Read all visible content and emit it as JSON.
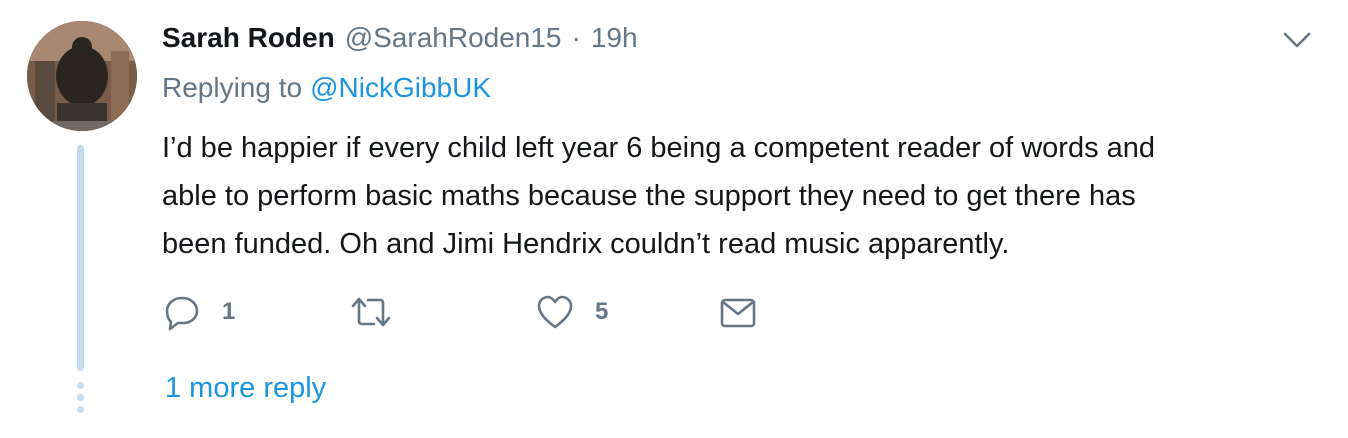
{
  "author": {
    "name": "Sarah Roden",
    "handle": "@SarahRoden15",
    "separator": "·",
    "time": "19h"
  },
  "replying": {
    "prefix": "Replying to",
    "mention": "@NickGibbUK"
  },
  "tweet": {
    "lines": [
      "I’d be happier if every child left year 6 being a competent reader of words  and",
      "able to perform basic maths because the support they need to get there has",
      "been funded. Oh and Jimi Hendrix couldn’t read music apparently."
    ]
  },
  "actions": {
    "reply_count": "1",
    "retweet_count": "",
    "like_count": "5"
  },
  "thread": {
    "more_replies": "1 more reply"
  },
  "icons": {
    "caret": "chevron-down-icon",
    "reply": "reply-icon",
    "retweet": "retweet-icon",
    "like": "heart-icon",
    "dm": "envelope-icon"
  },
  "colors": {
    "text": "#14171a",
    "muted": "#657786",
    "link": "#1b95e0",
    "thread_line": "#c4dcf0"
  }
}
